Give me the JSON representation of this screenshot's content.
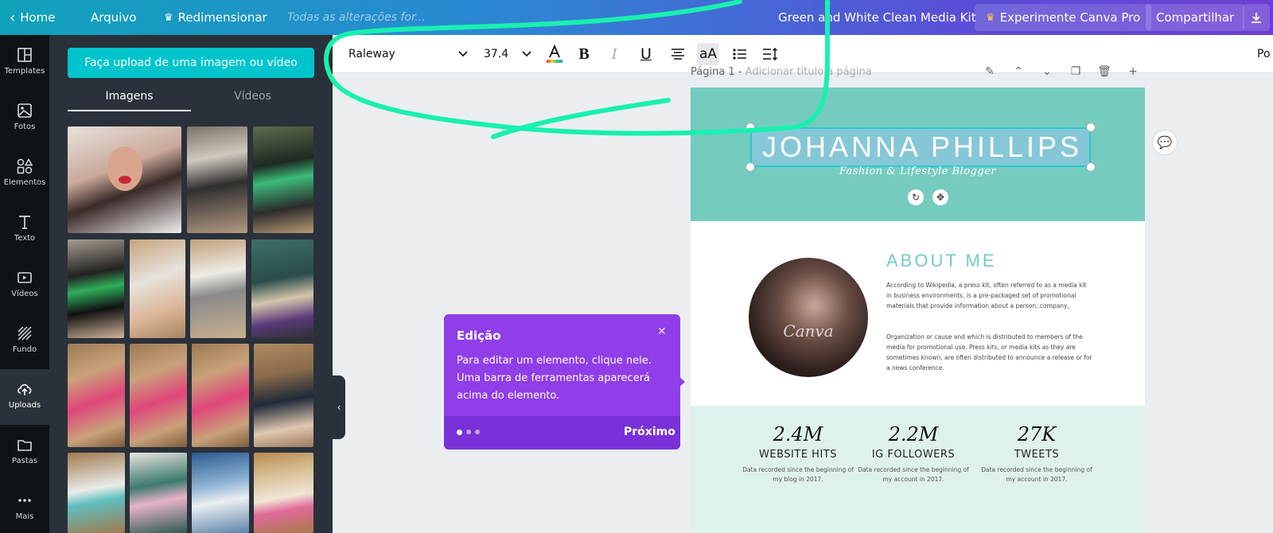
{
  "topbar": {
    "home": "Home",
    "arquivo": "Arquivo",
    "redimensionar": "Redimensionar",
    "saved_status": "Todas as alterações for...",
    "doc_title": "Green and White Clean Media Kit",
    "pro": "Experimente Canva Pro",
    "share": "Compartilhar"
  },
  "rail": {
    "items": [
      {
        "label": "Templates",
        "icon": "layout-icon"
      },
      {
        "label": "Fotos",
        "icon": "photo-icon"
      },
      {
        "label": "Elementos",
        "icon": "shapes-icon"
      },
      {
        "label": "Texto",
        "icon": "text-icon"
      },
      {
        "label": "Vídeos",
        "icon": "video-icon"
      },
      {
        "label": "Fundo",
        "icon": "background-icon"
      },
      {
        "label": "Uploads",
        "icon": "cloud-upload-icon"
      },
      {
        "label": "Pastas",
        "icon": "folder-icon"
      },
      {
        "label": "Mais",
        "icon": "more-icon"
      }
    ]
  },
  "panel": {
    "upload_button": "Faça upload de uma imagem ou vídeo",
    "tab_images": "Imagens",
    "tab_videos": "Vídeos"
  },
  "format_toolbar": {
    "font": "Raleway",
    "size": "37.4",
    "position": "Po"
  },
  "canvas": {
    "page_label": "Página 1 - ",
    "page_title_placeholder": "Adicionar título à página",
    "name": "JOHANNA PHILLIPS",
    "subtitle": "Fashion & Lifestyle Blogger",
    "about_heading": "ABOUT ME",
    "about_p1": "According to Wikipedia, a press kit, often referred to as a media kit in business environments, is a pre-packaged set of promotional materials that provide information about a person, company,",
    "about_p2": "Organization or cause and which is distributed to members of the media for promotional use. Press kits, or media kits as they are sometimes known, are often distributed to announce a release or for a news conference.",
    "avatar_watermark": "Canva",
    "stats": [
      {
        "num": "2.4M",
        "label": "WEBSITE HITS",
        "note": "Data recorded since the beginning of my blog in 2017."
      },
      {
        "num": "2.2M",
        "label": "IG FOLLOWERS",
        "note": "Data recorded since the beginning of my account in 2017."
      },
      {
        "num": "27K",
        "label": "TWEETS",
        "note": "Data recorded since the beginning of my account in 2017."
      }
    ]
  },
  "tooltip": {
    "title": "Edição",
    "body": "Para editar um elemento, clique nele. Uma barra de ferramentas aparecerá acima do elemento.",
    "next": "Próximo"
  },
  "colors": {
    "accent_teal": "#00c4cc",
    "header_teal": "#76cbbf",
    "tooltip_purple": "#8f3ee8",
    "scribble_green": "#19f0b0"
  }
}
